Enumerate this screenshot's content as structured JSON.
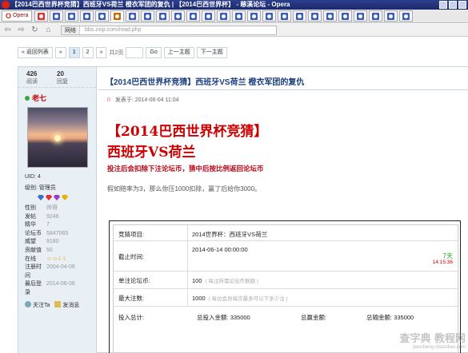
{
  "window": {
    "title": "【2014巴西世界杯竞猜】西班牙VS荷兰   橙衣军团的复仇 | 【2014巴西世界杯】 - 慈溪论坛 - Opera"
  },
  "browser": {
    "menu_label": "Opera",
    "tabs": [
      {
        "icon": "red-favicon-icon"
      },
      {
        "icon": "blue-favicon-icon"
      },
      {
        "icon": "blue-favicon-icon"
      },
      {
        "icon": "blue-favicon-icon"
      },
      {
        "icon": "blue-favicon-icon"
      },
      {
        "icon": "home-favicon-icon"
      },
      {
        "icon": "blue-favicon-icon"
      },
      {
        "icon": "blue-favicon-icon"
      },
      {
        "icon": "blue-favicon-icon"
      },
      {
        "icon": "blue-favicon-icon"
      },
      {
        "icon": "blue-favicon-icon"
      },
      {
        "icon": "blue-favicon-icon"
      },
      {
        "icon": "blue-favicon-icon"
      },
      {
        "icon": "blue-favicon-icon"
      },
      {
        "icon": "blue-favicon-icon"
      },
      {
        "icon": "blue-favicon-icon"
      },
      {
        "icon": "blue-favicon-icon"
      },
      {
        "icon": "blue-favicon-icon"
      },
      {
        "icon": "blue-favicon-icon"
      },
      {
        "icon": "blue-favicon-icon"
      },
      {
        "icon": "blue-favicon-icon"
      },
      {
        "icon": "blue-favicon-icon"
      },
      {
        "icon": "blue-favicon-icon"
      },
      {
        "icon": "blue-favicon-icon"
      },
      {
        "icon": "blue-favicon-icon"
      }
    ],
    "address_label": "网络",
    "url": "bbs.zxip.com/read.php"
  },
  "pager": {
    "back": "« 返回列表",
    "prev": "«",
    "page1": "1",
    "page2": "2",
    "next": "»",
    "total": "共2页",
    "go": "Go",
    "prev_topic": "上一主题",
    "next_topic": "下一主题"
  },
  "user": {
    "views": "426",
    "views_label": "阅读",
    "replies": "20",
    "replies_label": "回复",
    "name": "老七",
    "uid": "UID: 4",
    "rank": "级别: 管理员",
    "fields": [
      {
        "k": "性别",
        "v": "帅哥"
      },
      {
        "k": "发帖",
        "v": "9246"
      },
      {
        "k": "精华",
        "v": "7"
      },
      {
        "k": "论坛币",
        "v": "5847065"
      },
      {
        "k": "威望",
        "v": "9180"
      },
      {
        "k": "贡献值",
        "v": "50"
      }
    ],
    "online_label": "在线",
    "online_icons": "☺☺☾☾",
    "fields2": [
      {
        "k": "注册时间",
        "v": "2004-04-06"
      },
      {
        "k": "最后登录",
        "v": "2014-06-06"
      }
    ],
    "follow": "关注Ta",
    "message": "发消息"
  },
  "post": {
    "thread_title": "【2014巴西世界杯竞猜】西班牙VS荷兰   橙衣军团的复仇",
    "floor": "0",
    "posted": "发表于: 2014-06-04 11:04",
    "headline1": "【2014巴西世界杯竞猜】",
    "headline2": "西班牙VS荷兰",
    "subline": "投注后会扣除下注论坛币，猜中后按比例返回论坛币",
    "note": "假如赔率为3，那么你压1000扣除，赢了后给你3000。"
  },
  "bet": {
    "item_label": "竞猜项目:",
    "item_value": "2014世界杯：西班牙VS荷兰",
    "deadline_label": "截止时间:",
    "deadline_value": "2014-06-14 00:00:00",
    "countdown_days": "7天",
    "countdown_time": "14:15:36",
    "unit_label": "单注论坛币:",
    "unit_value": "100",
    "unit_hint": "( 每注所需论坛币数额 )",
    "max_label": "最大注数:",
    "max_value": "1000",
    "max_hint": "( 每位会员每次最多可以下多少注 )",
    "total_label": "投入总计:",
    "total_bets_label": "总投入金额:",
    "total_bets_value": "335000",
    "total_amount_label": "总赢金额:",
    "total_win_label": "总输金额:",
    "total_win_value": "335000"
  },
  "watermark": {
    "line1": "查字典 教程网",
    "line2": "jiaocheng.chazidian.com"
  }
}
